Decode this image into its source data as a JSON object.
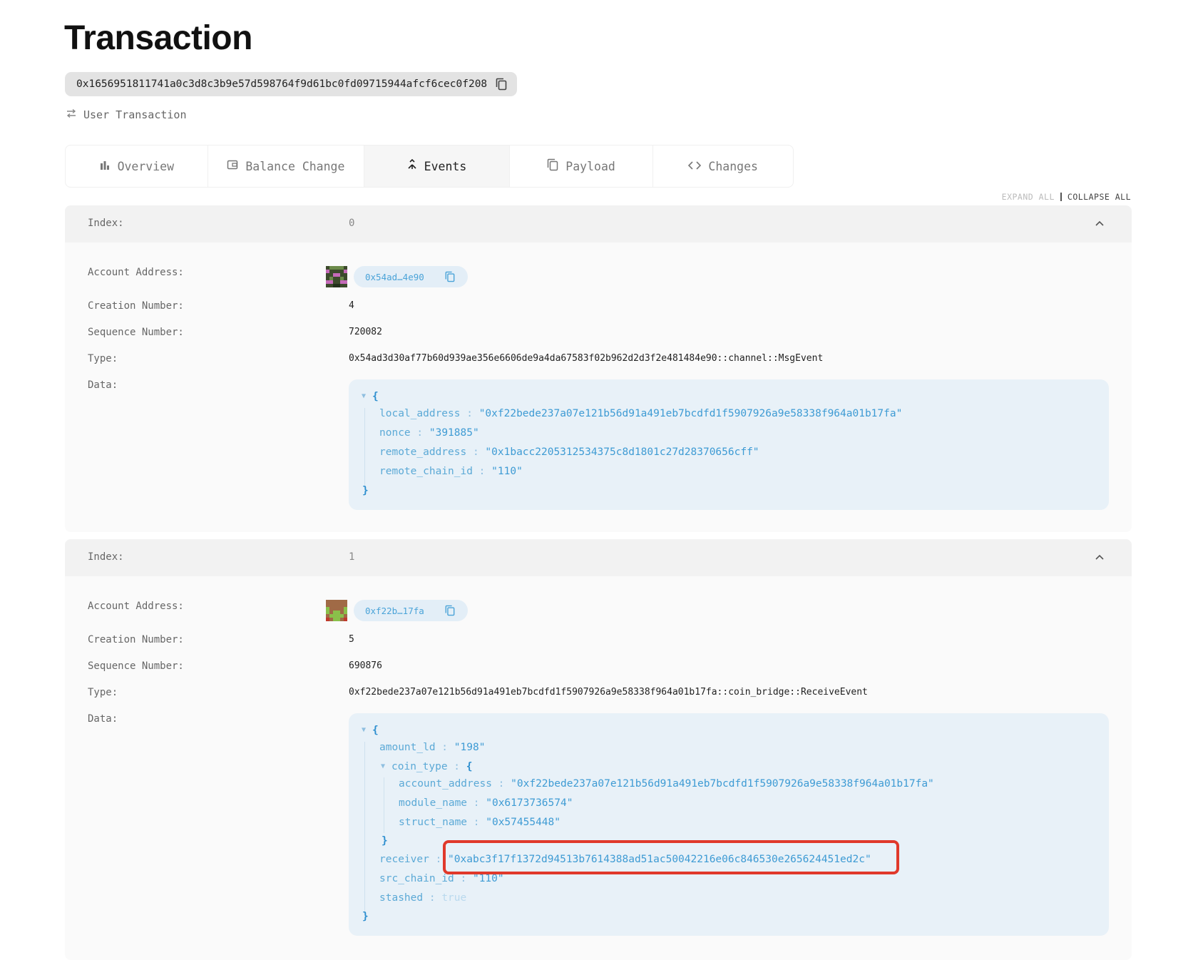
{
  "page": {
    "title": "Transaction",
    "hash": "0x1656951811741a0c3d8c3b9e57d598764f9d61bc0fd09715944afcf6cec0f208",
    "tx_type": "User Transaction"
  },
  "tabs": [
    {
      "label": "Overview",
      "icon": "bar-chart-icon"
    },
    {
      "label": "Balance Change",
      "icon": "wallet-icon"
    },
    {
      "label": "Events",
      "icon": "merge-icon",
      "active": true
    },
    {
      "label": "Payload",
      "icon": "copy-icon"
    },
    {
      "label": "Changes",
      "icon": "code-icon"
    }
  ],
  "controls": {
    "expand_all": "EXPAND ALL",
    "collapse_all": "COLLAPSE ALL"
  },
  "labels": {
    "index": "Index:",
    "account_address": "Account Address:",
    "creation_number": "Creation Number:",
    "sequence_number": "Sequence Number:",
    "type": "Type:",
    "data": "Data:"
  },
  "events": [
    {
      "index": "0",
      "account_address": "0x54ad…4e90",
      "creation_number": "4",
      "sequence_number": "720082",
      "type": "0x54ad3d30af77b60d939ae356e6606de9a4da67583f02b962d2d3f2e481484e90::channel::MsgEvent",
      "data": {
        "local_address": "\"0xf22bede237a07e121b56d91a491eb7bcdfd1f5907926a9e58338f964a01b17fa\"",
        "nonce": "\"391885\"",
        "remote_address": "\"0x1bacc2205312534375c8d1801c27d28370656cff\"",
        "remote_chain_id": "\"110\""
      }
    },
    {
      "index": "1",
      "account_address": "0xf22b…17fa",
      "creation_number": "5",
      "sequence_number": "690876",
      "type": "0xf22bede237a07e121b56d91a491eb7bcdfd1f5907926a9e58338f964a01b17fa::coin_bridge::ReceiveEvent",
      "data": {
        "amount_ld": "\"198\"",
        "coin_type": {
          "account_address": "\"0xf22bede237a07e121b56d91a491eb7bcdfd1f5907926a9e58338f964a01b17fa\"",
          "module_name": "\"0x6173736574\"",
          "struct_name": "\"0x57455448\""
        },
        "receiver": "\"0xabc3f17f1372d94513b7614388ad51ac50042216e06c846530e265624451ed2c\"",
        "src_chain_id": "\"110\"",
        "stashed": "true"
      }
    }
  ],
  "colors": {
    "accent": "#4aa3d8",
    "highlight": "#e0392b"
  }
}
